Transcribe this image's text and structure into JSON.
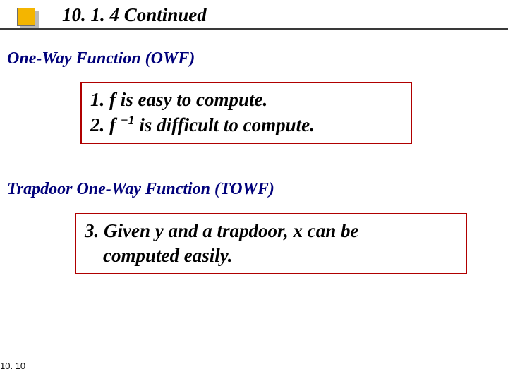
{
  "title": "10. 1. 4  Continued",
  "subhead_owf": "One-Way Function (OWF)",
  "subhead_towf": "Trapdoor One-Way Function (TOWF)",
  "box1": {
    "line1": "1. f is easy to compute.",
    "line2_pre": "2.  f ",
    "line2_sup": "−1",
    "line2_post": " is difficult to compute."
  },
  "box2": {
    "line1": "3. Given y and a trapdoor, x can be",
    "line2": "computed easily."
  },
  "pagenum": "10. 10"
}
